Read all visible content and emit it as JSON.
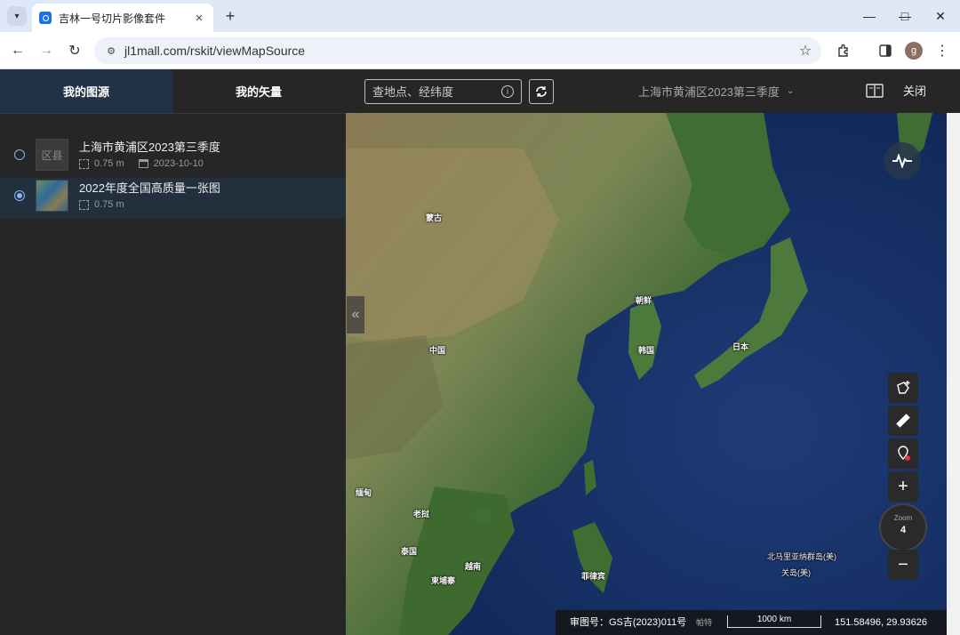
{
  "browser": {
    "tab_title": "吉林一号切片影像套件",
    "url": "jl1mall.com/rskit/viewMapSource",
    "new_tab": "+",
    "avatar_letter": "g",
    "window": {
      "minimize": "—",
      "maximize": "□",
      "close": "✕"
    }
  },
  "header": {
    "tabs": [
      {
        "label": "我的图源",
        "active": true
      },
      {
        "label": "我的矢量",
        "active": false
      }
    ],
    "search_placeholder": "查地点、经纬度",
    "current_layer": "上海市黄浦区2023第三季度",
    "close_label": "关闭"
  },
  "sidebar": {
    "items": [
      {
        "title": "上海市黄浦区2023第三季度",
        "thumb_text": "区县",
        "resolution": "0.75 m",
        "date": "2023-10-10",
        "selected": false
      },
      {
        "title": "2022年度全国高质量一张图",
        "resolution": "0.75 m",
        "selected": true
      }
    ]
  },
  "map": {
    "labels": [
      {
        "name": "蒙古"
      },
      {
        "name": "中国"
      },
      {
        "name": "朝鲜"
      },
      {
        "name": "韩国"
      },
      {
        "name": "日本"
      },
      {
        "name": "缅甸"
      },
      {
        "name": "老挝"
      },
      {
        "name": "泰国"
      },
      {
        "name": "越南"
      },
      {
        "name": "柬埔寨"
      },
      {
        "name": "菲律宾"
      },
      {
        "name": "北马里亚纳群岛(美)"
      },
      {
        "name": "关岛(美)"
      }
    ],
    "zoom_label": "Zoom",
    "zoom_level": "4",
    "approval_no": "审图号：GS吉(2023)011号",
    "scale_label": "1000 km",
    "coordinates": "151.58496, 29.93626",
    "attribution_small": "帕特"
  },
  "colors": {
    "accent": "#8ab4f8",
    "panel": "#262626",
    "selected_row": "#22303e"
  }
}
